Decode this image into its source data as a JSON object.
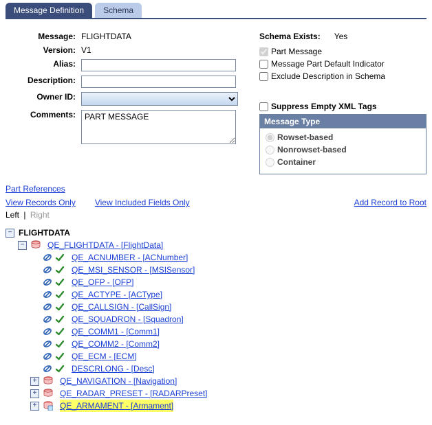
{
  "tabs": {
    "active": "Message Definition",
    "inactive": "Schema"
  },
  "form": {
    "labels": {
      "message": "Message:",
      "version": "Version:",
      "alias": "Alias:",
      "description": "Description:",
      "owner": "Owner ID:",
      "comments": "Comments:"
    },
    "values": {
      "message": "FLIGHTDATA",
      "version": "V1",
      "alias": "",
      "description": "",
      "owner": "",
      "comments": "PART MESSAGE"
    }
  },
  "schema": {
    "exists_label": "Schema Exists:",
    "exists_value": "Yes",
    "part_message": "Part Message",
    "default_ind": "Message Part Default Indicator",
    "exclude_desc": "Exclude Description in Schema",
    "suppress": "Suppress Empty XML Tags"
  },
  "msg_type": {
    "header": "Message Type",
    "rowset": "Rowset-based",
    "nonrowset": "Nonrowset-based",
    "container": "Container"
  },
  "links": {
    "part_ref": "Part References",
    "records_only": "View Records Only",
    "fields_only": "View Included Fields Only",
    "add_record": "Add Record to Root",
    "left": "Left",
    "right": "Right"
  },
  "tree": {
    "root": "FLIGHTDATA",
    "record": "QE_FLIGHTDATA - [FlightData]",
    "fields": [
      "QE_ACNUMBER - [ACNumber]",
      "QE_MSI_SENSOR - [MSISensor]",
      "QE_OFP - [OFP]",
      "QE_ACTYPE - [ACType]",
      "QE_CALLSIGN - [CallSign]",
      "QE_SQUADRON - [Squadron]",
      "QE_COMM1 - [Comm1]",
      "QE_COMM2 - [Comm2]",
      "QE_ECM - [ECM]",
      "DESCRLONG - [Desc]"
    ],
    "children_tables": [
      "QE_NAVIGATION - [Navigation]",
      "QE_RADAR_PRESET - [RADARPreset]"
    ],
    "highlighted_child": "QE_ARMAMENT - [Armament]"
  }
}
